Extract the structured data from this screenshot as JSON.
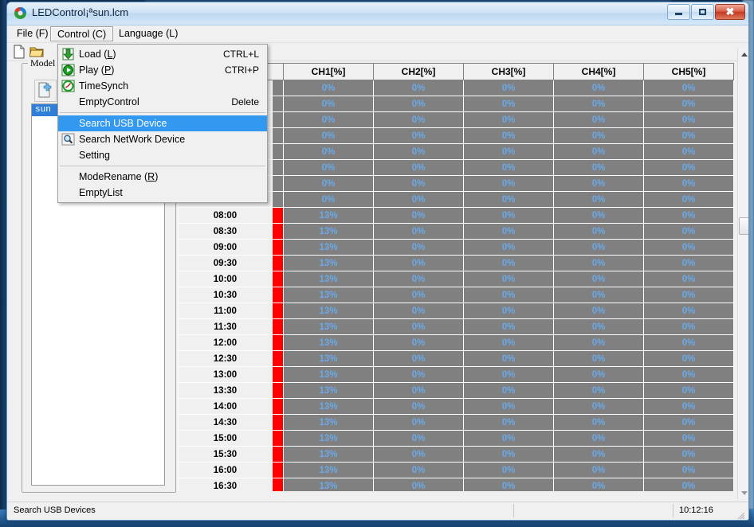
{
  "window": {
    "title": "LEDControl¡ªsun.lcm",
    "icon": "app-led-icon",
    "buttons": {
      "minimize": "minimize",
      "maximize": "maximize",
      "close": "close"
    }
  },
  "menubar": {
    "items": [
      {
        "label": "File (F)",
        "name": "menu-file"
      },
      {
        "label": "Control (C)",
        "name": "menu-control",
        "active": true
      },
      {
        "label": "Language (L)",
        "name": "menu-language"
      }
    ]
  },
  "toolbar": {
    "buttons": [
      {
        "name": "new-file-icon",
        "title": "New"
      },
      {
        "name": "open-folder-icon",
        "title": "Open"
      }
    ]
  },
  "dropdown": {
    "open": true,
    "owner": "Control (C)",
    "items": [
      {
        "label": "Load (L)",
        "accel": "CTRL+L",
        "icon": "download-arrow-icon",
        "underline": "L",
        "highlighted": false
      },
      {
        "label": "Play (P)",
        "accel": "CTRI+P",
        "icon": "play-circle-icon",
        "underline": "P",
        "highlighted": false
      },
      {
        "label": "TimeSynch",
        "accel": "",
        "icon": "clock-sync-icon",
        "highlighted": false
      },
      {
        "label": "EmptyControl",
        "accel": "Delete",
        "icon": "",
        "highlighted": false
      },
      {
        "separator": true
      },
      {
        "label": "Search USB Device",
        "accel": "",
        "icon": "",
        "highlighted": true
      },
      {
        "label": "Search NetWork Device",
        "accel": "",
        "icon": "magnifier-icon",
        "highlighted": false
      },
      {
        "label": "Setting",
        "accel": "",
        "icon": "",
        "highlighted": false
      },
      {
        "separator": true
      },
      {
        "label": "ModeRename (R)",
        "accel": "",
        "icon": "",
        "underline": "R",
        "highlighted": false
      },
      {
        "label": "EmptyList",
        "accel": "",
        "icon": "",
        "highlighted": false
      }
    ]
  },
  "model_panel": {
    "legend": "Model",
    "new_button": "new-model-icon",
    "list": [
      {
        "label": "sun",
        "selected": true
      }
    ]
  },
  "table": {
    "time_header": "",
    "columns": [
      "CH1[%]",
      "CH2[%]",
      "CH3[%]",
      "CH4[%]",
      "CH5[%]"
    ],
    "rows": [
      {
        "time": "",
        "flag": false,
        "values": [
          "0%",
          "0%",
          "0%",
          "0%",
          "0%"
        ]
      },
      {
        "time": "",
        "flag": false,
        "values": [
          "0%",
          "0%",
          "0%",
          "0%",
          "0%"
        ]
      },
      {
        "time": "",
        "flag": false,
        "values": [
          "0%",
          "0%",
          "0%",
          "0%",
          "0%"
        ]
      },
      {
        "time": "",
        "flag": false,
        "values": [
          "0%",
          "0%",
          "0%",
          "0%",
          "0%"
        ]
      },
      {
        "time": "",
        "flag": false,
        "values": [
          "0%",
          "0%",
          "0%",
          "0%",
          "0%"
        ]
      },
      {
        "time": "",
        "flag": false,
        "values": [
          "0%",
          "0%",
          "0%",
          "0%",
          "0%"
        ]
      },
      {
        "time": "",
        "flag": false,
        "values": [
          "0%",
          "0%",
          "0%",
          "0%",
          "0%"
        ]
      },
      {
        "time": "",
        "flag": false,
        "values": [
          "0%",
          "0%",
          "0%",
          "0%",
          "0%"
        ]
      },
      {
        "time": "08:00",
        "flag": true,
        "values": [
          "13%",
          "0%",
          "0%",
          "0%",
          "0%"
        ]
      },
      {
        "time": "08:30",
        "flag": true,
        "values": [
          "13%",
          "0%",
          "0%",
          "0%",
          "0%"
        ]
      },
      {
        "time": "09:00",
        "flag": true,
        "values": [
          "13%",
          "0%",
          "0%",
          "0%",
          "0%"
        ]
      },
      {
        "time": "09:30",
        "flag": true,
        "values": [
          "13%",
          "0%",
          "0%",
          "0%",
          "0%"
        ]
      },
      {
        "time": "10:00",
        "flag": true,
        "values": [
          "13%",
          "0%",
          "0%",
          "0%",
          "0%"
        ]
      },
      {
        "time": "10:30",
        "flag": true,
        "values": [
          "13%",
          "0%",
          "0%",
          "0%",
          "0%"
        ]
      },
      {
        "time": "11:00",
        "flag": true,
        "values": [
          "13%",
          "0%",
          "0%",
          "0%",
          "0%"
        ]
      },
      {
        "time": "11:30",
        "flag": true,
        "values": [
          "13%",
          "0%",
          "0%",
          "0%",
          "0%"
        ]
      },
      {
        "time": "12:00",
        "flag": true,
        "values": [
          "13%",
          "0%",
          "0%",
          "0%",
          "0%"
        ]
      },
      {
        "time": "12:30",
        "flag": true,
        "values": [
          "13%",
          "0%",
          "0%",
          "0%",
          "0%"
        ]
      },
      {
        "time": "13:00",
        "flag": true,
        "values": [
          "13%",
          "0%",
          "0%",
          "0%",
          "0%"
        ]
      },
      {
        "time": "13:30",
        "flag": true,
        "values": [
          "13%",
          "0%",
          "0%",
          "0%",
          "0%"
        ]
      },
      {
        "time": "14:00",
        "flag": true,
        "values": [
          "13%",
          "0%",
          "0%",
          "0%",
          "0%"
        ]
      },
      {
        "time": "14:30",
        "flag": true,
        "values": [
          "13%",
          "0%",
          "0%",
          "0%",
          "0%"
        ]
      },
      {
        "time": "15:00",
        "flag": true,
        "values": [
          "13%",
          "0%",
          "0%",
          "0%",
          "0%"
        ]
      },
      {
        "time": "15:30",
        "flag": true,
        "values": [
          "13%",
          "0%",
          "0%",
          "0%",
          "0%"
        ]
      },
      {
        "time": "16:00",
        "flag": true,
        "values": [
          "13%",
          "0%",
          "0%",
          "0%",
          "0%"
        ]
      },
      {
        "time": "16:30",
        "flag": true,
        "values": [
          "13%",
          "0%",
          "0%",
          "0%",
          "0%"
        ]
      }
    ]
  },
  "scrollbar": {
    "up_arrow": "scroll-up-arrow-icon",
    "down_arrow": "scroll-down-arrow-icon",
    "thumb": "scroll-thumb"
  },
  "statusbar": {
    "message": "Search USB Devices",
    "middle": "",
    "time": "10:12:16"
  },
  "colors": {
    "highlight": "#3399f0",
    "flag_red": "#ff0000",
    "cell_bg": "#808080",
    "cell_text": "#6aa9e8",
    "selection": "#2f7fd8"
  }
}
